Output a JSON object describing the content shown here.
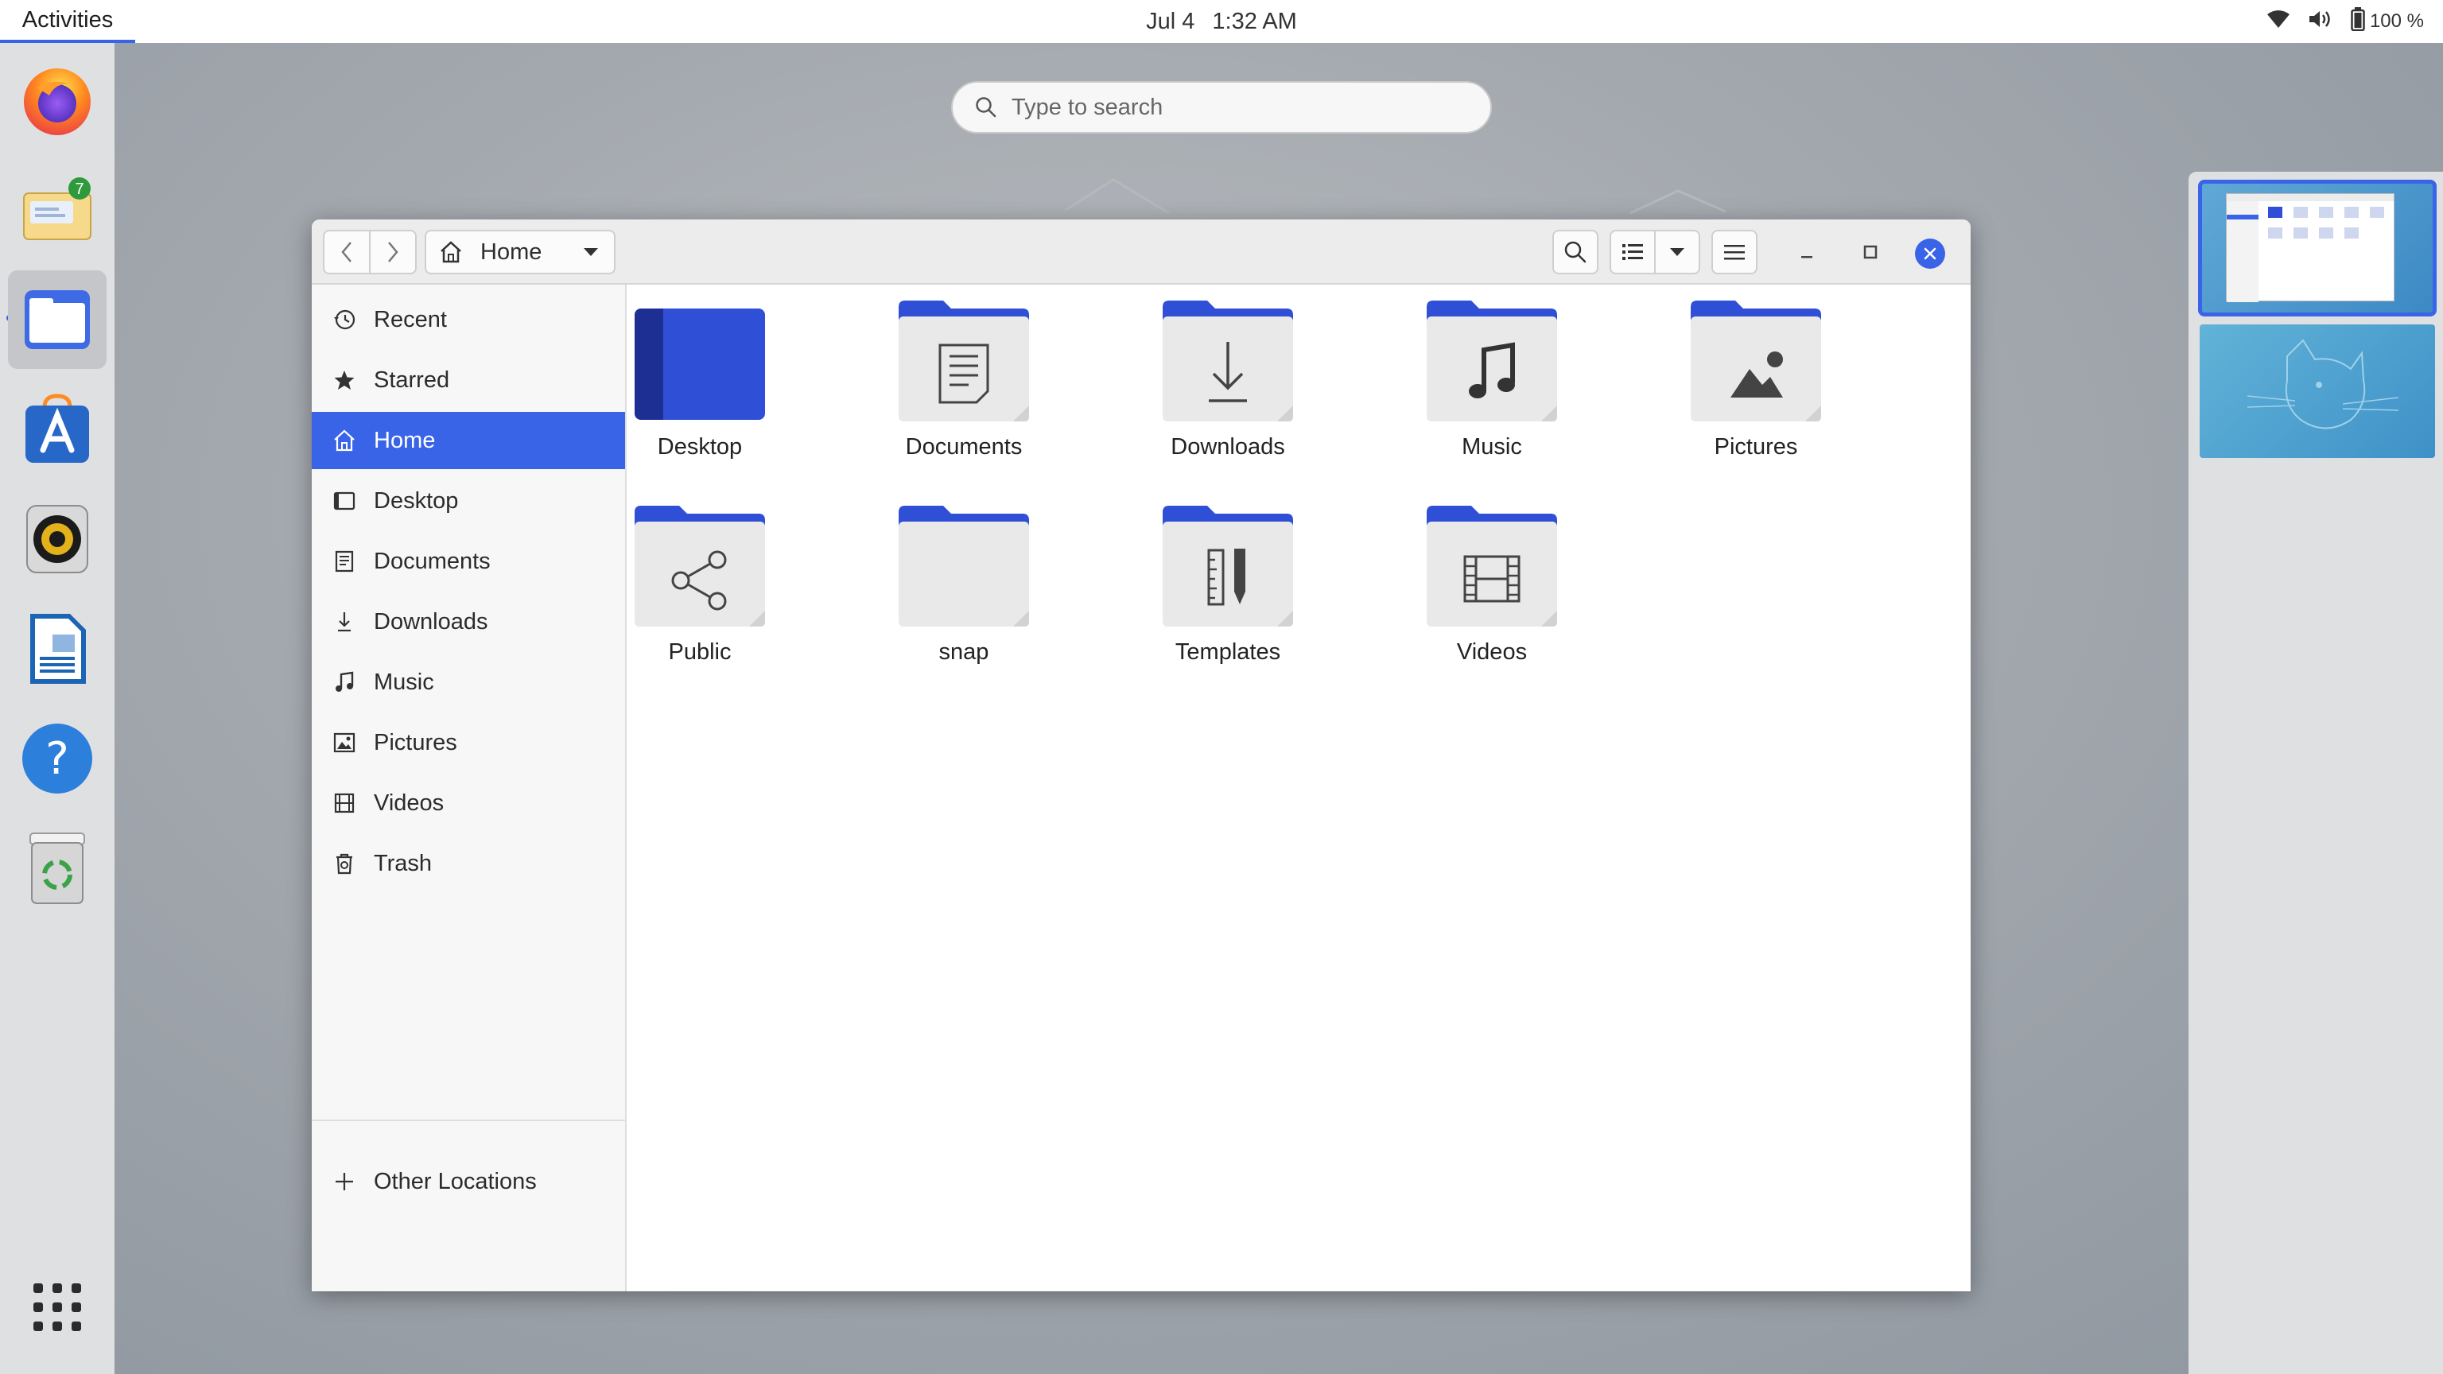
{
  "topbar": {
    "activities": "Activities",
    "date": "Jul 4",
    "time": "1:32 AM",
    "battery": "100 %",
    "icons": [
      "wifi-icon",
      "volume-icon",
      "battery-icon"
    ]
  },
  "dock": {
    "apps": [
      {
        "name": "firefox",
        "icon": "firefox-icon"
      },
      {
        "name": "thunderbird",
        "icon": "mail-icon",
        "badge": "7"
      },
      {
        "name": "files",
        "icon": "files-icon",
        "active": true
      },
      {
        "name": "software",
        "icon": "app-store-icon"
      },
      {
        "name": "rhythmbox",
        "icon": "speaker-icon"
      },
      {
        "name": "writer",
        "icon": "document-icon"
      },
      {
        "name": "help",
        "icon": "help-icon"
      },
      {
        "name": "trash",
        "icon": "trash-icon"
      }
    ],
    "app_grid_icon": "app-grid-icon"
  },
  "search": {
    "placeholder": "Type to search"
  },
  "window": {
    "path_label": "Home",
    "sidebar": [
      {
        "label": "Recent",
        "icon": "recent-icon"
      },
      {
        "label": "Starred",
        "icon": "star-icon"
      },
      {
        "label": "Home",
        "icon": "home-icon",
        "selected": true
      },
      {
        "label": "Desktop",
        "icon": "desktop-icon"
      },
      {
        "label": "Documents",
        "icon": "documents-icon"
      },
      {
        "label": "Downloads",
        "icon": "downloads-icon"
      },
      {
        "label": "Music",
        "icon": "music-icon"
      },
      {
        "label": "Pictures",
        "icon": "pictures-icon"
      },
      {
        "label": "Videos",
        "icon": "videos-icon"
      },
      {
        "label": "Trash",
        "icon": "trash-icon"
      }
    ],
    "other_locations": "Other Locations",
    "files": [
      {
        "name": "Desktop",
        "icon": "desktop-folder-icon"
      },
      {
        "name": "Documents",
        "icon": "documents-folder-icon"
      },
      {
        "name": "Downloads",
        "icon": "downloads-folder-icon"
      },
      {
        "name": "Music",
        "icon": "music-folder-icon"
      },
      {
        "name": "Pictures",
        "icon": "pictures-folder-icon"
      },
      {
        "name": "Public",
        "icon": "public-folder-icon"
      },
      {
        "name": "snap",
        "icon": "folder-icon"
      },
      {
        "name": "Templates",
        "icon": "templates-folder-icon"
      },
      {
        "name": "Videos",
        "icon": "videos-folder-icon"
      }
    ]
  },
  "colors": {
    "accent": "#3a64e8",
    "folder_tab": "#2f4fd6",
    "folder_body": "#ececec"
  }
}
